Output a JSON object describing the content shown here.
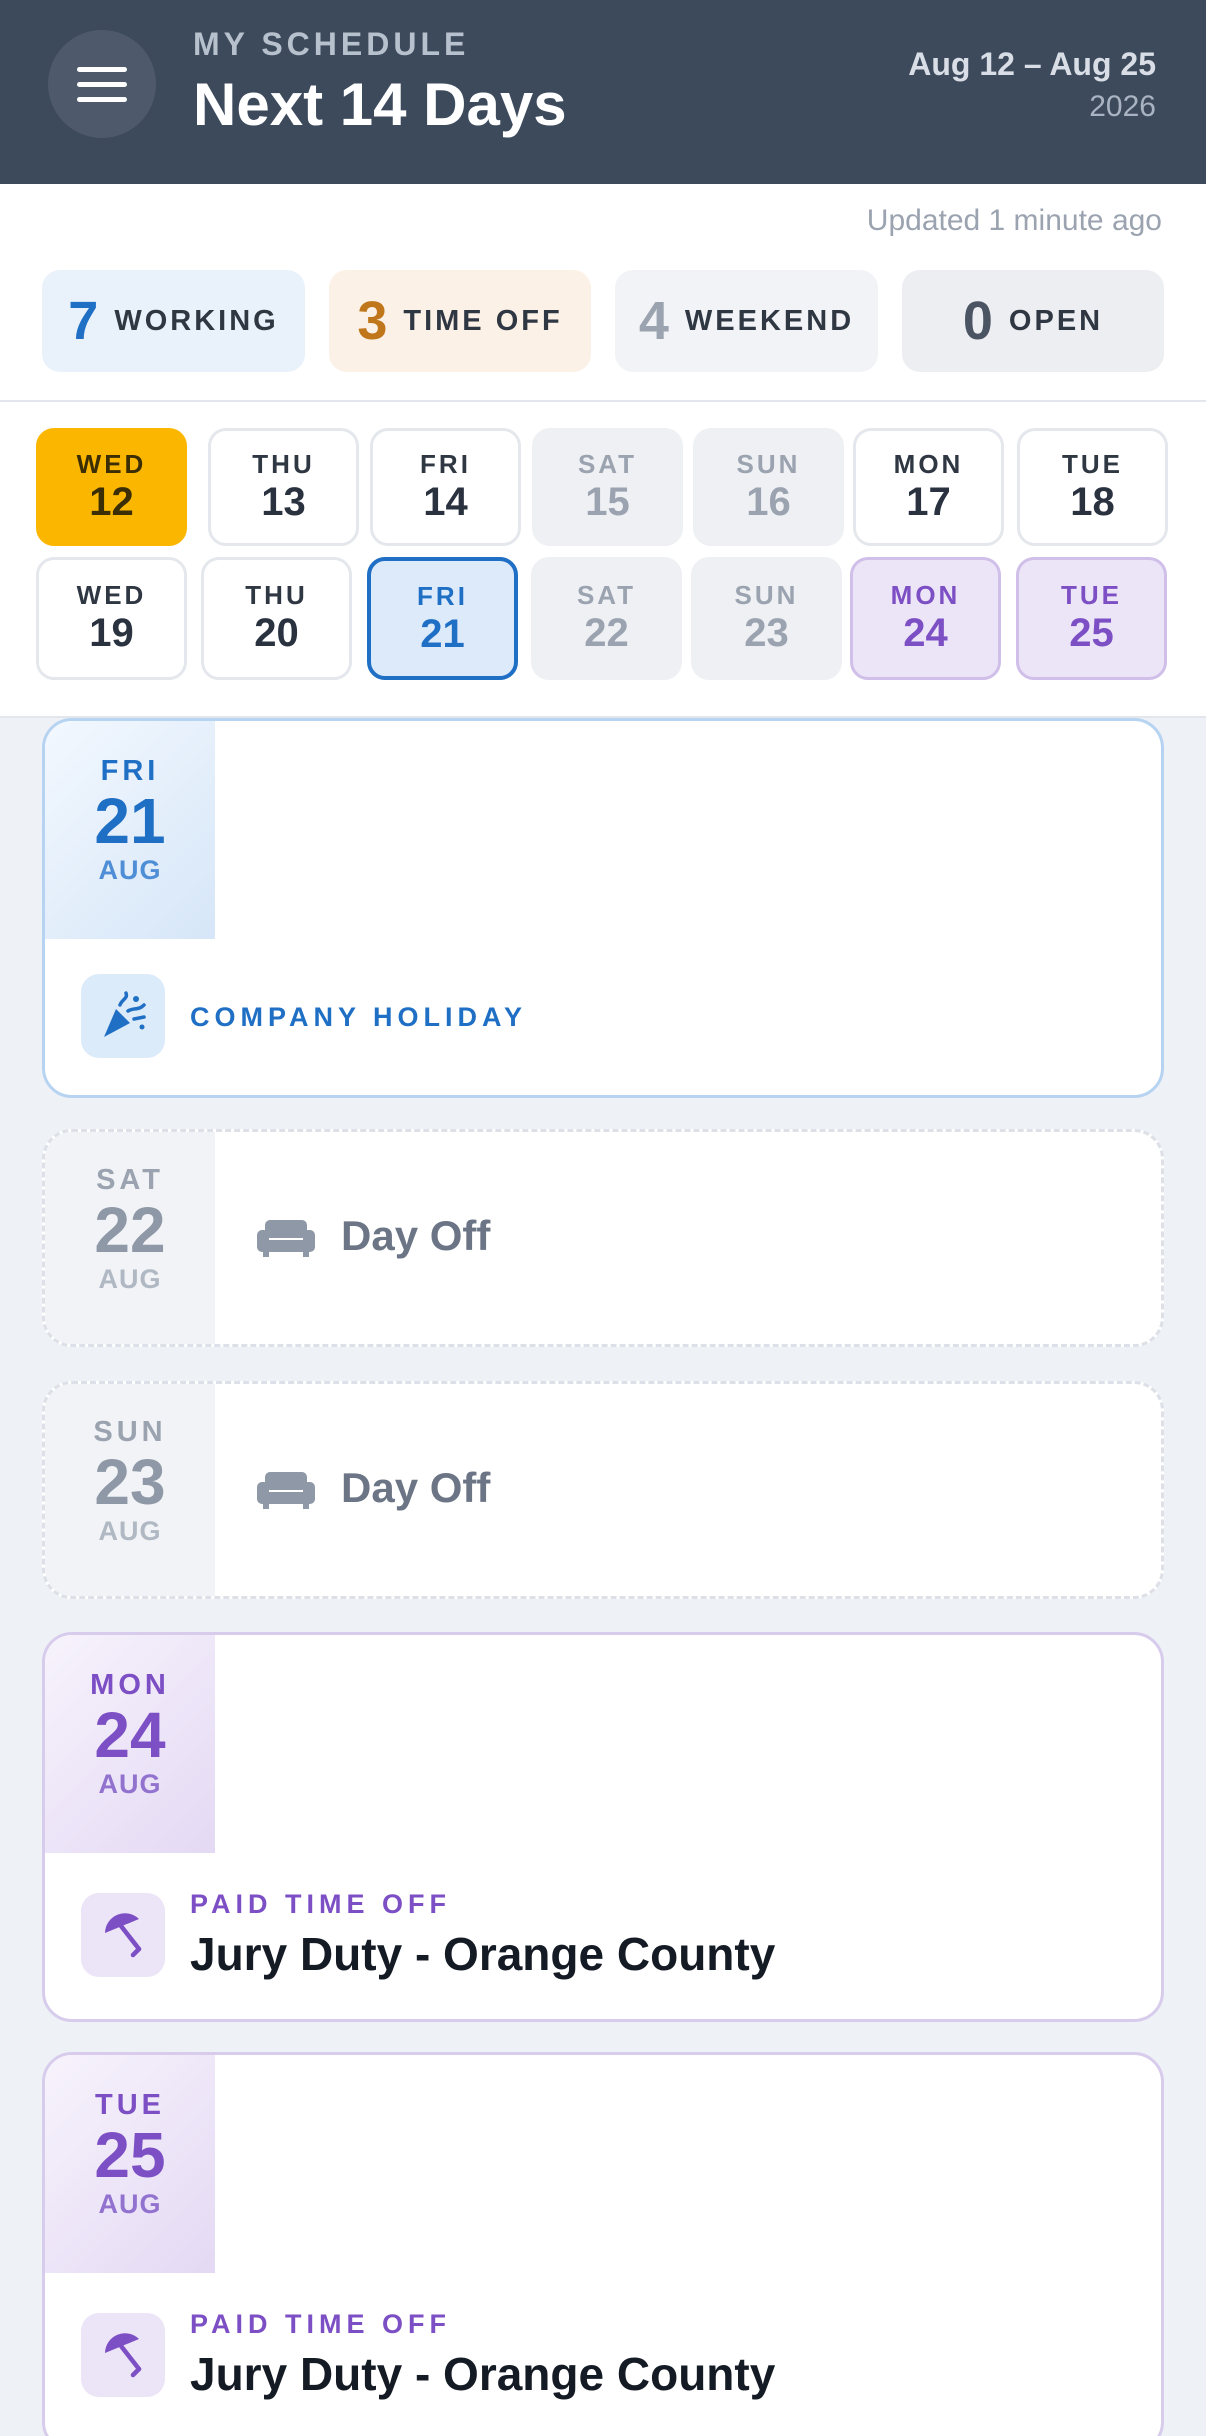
{
  "header": {
    "eyebrow": "MY SCHEDULE",
    "title": "Next 14 Days",
    "range": "Aug 12 – Aug 25",
    "year": "2026",
    "menu_icon": "hamburger-menu-icon"
  },
  "summary": {
    "updated": "Updated 1 minute ago",
    "stats": [
      {
        "num": "7",
        "label": "WORKING"
      },
      {
        "num": "3",
        "label": "TIME OFF"
      },
      {
        "num": "4",
        "label": "WEEKEND"
      },
      {
        "num": "0",
        "label": "OPEN"
      }
    ]
  },
  "days": [
    {
      "dow": "WED",
      "num": "12",
      "state": "today"
    },
    {
      "dow": "THU",
      "num": "13",
      "state": "normal"
    },
    {
      "dow": "FRI",
      "num": "14",
      "state": "normal"
    },
    {
      "dow": "SAT",
      "num": "15",
      "state": "weekend"
    },
    {
      "dow": "SUN",
      "num": "16",
      "state": "weekend"
    },
    {
      "dow": "MON",
      "num": "17",
      "state": "normal"
    },
    {
      "dow": "TUE",
      "num": "18",
      "state": "normal"
    },
    {
      "dow": "WED",
      "num": "19",
      "state": "normal"
    },
    {
      "dow": "THU",
      "num": "20",
      "state": "normal"
    },
    {
      "dow": "FRI",
      "num": "21",
      "state": "selected"
    },
    {
      "dow": "SAT",
      "num": "22",
      "state": "weekend"
    },
    {
      "dow": "SUN",
      "num": "23",
      "state": "weekend"
    },
    {
      "dow": "MON",
      "num": "24",
      "state": "pto"
    },
    {
      "dow": "TUE",
      "num": "25",
      "state": "pto"
    }
  ],
  "cards": {
    "holiday": {
      "dow": "FRI",
      "num": "21",
      "month": "AUG",
      "tag": "COMPANY HOLIDAY",
      "icon": "party-popper-icon"
    },
    "off1": {
      "dow": "SAT",
      "num": "22",
      "month": "AUG",
      "label": "Day Off",
      "icon": "couch-icon"
    },
    "off2": {
      "dow": "SUN",
      "num": "23",
      "month": "AUG",
      "label": "Day Off",
      "icon": "couch-icon"
    },
    "pto1": {
      "dow": "MON",
      "num": "24",
      "month": "AUG",
      "tag": "PAID TIME OFF",
      "title": "Jury Duty - Orange County",
      "icon": "umbrella-icon"
    },
    "pto2": {
      "dow": "TUE",
      "num": "25",
      "month": "AUG",
      "tag": "PAID TIME OFF",
      "title": "Jury Duty - Orange County",
      "icon": "umbrella-icon"
    }
  },
  "colors": {
    "header_bg": "#3d4a5c",
    "today": "#fbb700",
    "selected": "#1f6fc5",
    "pto": "#7c4fc4",
    "timeoff_num": "#c0761a"
  }
}
